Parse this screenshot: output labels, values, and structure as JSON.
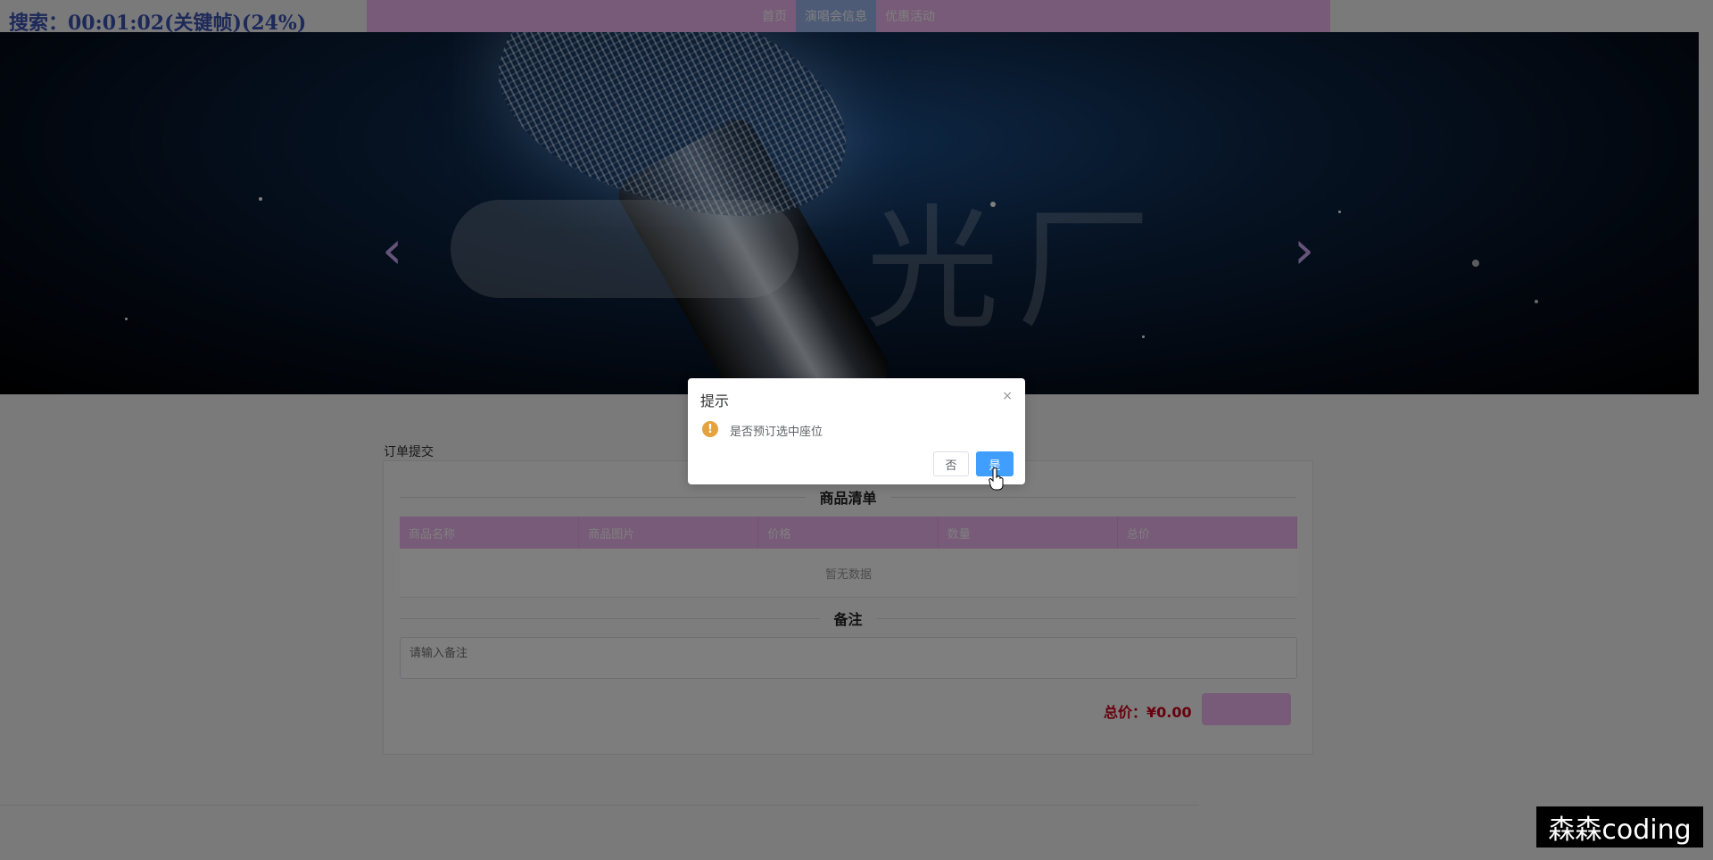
{
  "overlay": {
    "title": "搜索：00:01:02(关键帧)(24%)"
  },
  "nav": {
    "items": [
      "首页",
      "演唱会信息",
      "优惠活动"
    ],
    "active": 1
  },
  "banner": {
    "watermark_text": "光厂",
    "prev_arrow": "‹",
    "next_arrow": "›"
  },
  "order": {
    "section_label": "订单提交",
    "goods_title": "商品清单",
    "columns": [
      "商品名称",
      "商品图片",
      "价格",
      "数量",
      "总价"
    ],
    "empty_text": "暂无数据",
    "remark_title": "备注",
    "remark_placeholder": "请输入备注",
    "total_label": "总价：",
    "total_value": "¥0.00",
    "submit_label": ""
  },
  "dialog": {
    "title": "提示",
    "close": "×",
    "icon": "!",
    "message": "是否预订选中座位",
    "no_label": "否",
    "yes_label": "是"
  },
  "brand": {
    "text": "森森coding"
  },
  "colors": {
    "accent": "#f0b6f0",
    "primary": "#409eff",
    "warning": "#e6a23c",
    "price": "#d0021b"
  }
}
